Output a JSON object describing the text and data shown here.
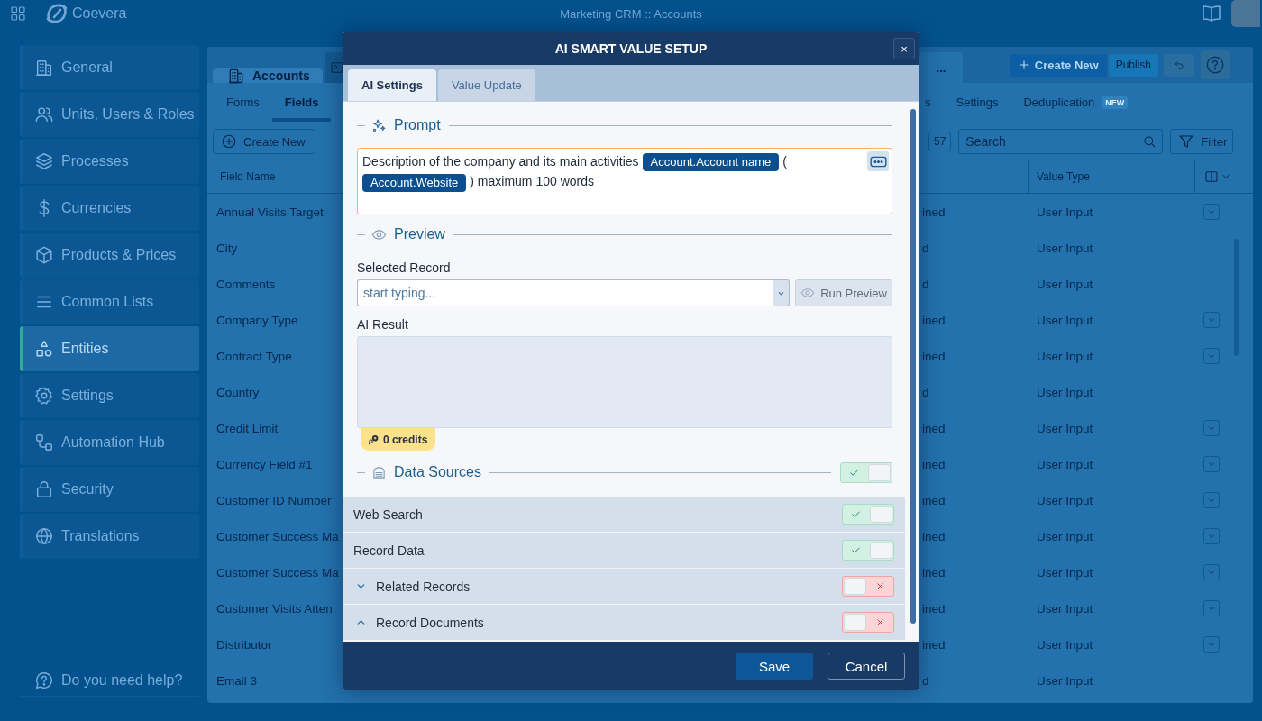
{
  "app": {
    "brand": "Coevera",
    "title": "Marketing CRM :: Accounts"
  },
  "sidebar": {
    "items": [
      {
        "label": "General",
        "selected": false
      },
      {
        "label": "Units, Users & Roles",
        "selected": false
      },
      {
        "label": "Processes",
        "selected": false
      },
      {
        "label": "Currencies",
        "selected": false
      },
      {
        "label": "Products & Prices",
        "selected": false
      },
      {
        "label": "Common Lists",
        "selected": false
      },
      {
        "label": "Entities",
        "selected": true
      },
      {
        "label": "Settings",
        "selected": false
      },
      {
        "label": "Automation Hub",
        "selected": false
      },
      {
        "label": "Security",
        "selected": false
      },
      {
        "label": "Translations",
        "selected": false
      }
    ],
    "help": "Do you need help?"
  },
  "main": {
    "tabs": [
      {
        "label": "Accounts",
        "selected": true
      },
      {
        "selected": false
      }
    ],
    "more_tabs": "...",
    "actions": [
      {
        "kind": "add",
        "label": "Create New",
        "disabled": false
      },
      {
        "kind": "plain",
        "label": "Publish",
        "disabled": true
      }
    ],
    "subtabs": [
      {
        "label": "Forms",
        "selected": false
      },
      {
        "label": "Fields",
        "selected": true
      },
      {
        "label": "s",
        "selected": false
      },
      {
        "label": "Settings",
        "selected": false
      },
      {
        "label": "Deduplication",
        "selected": false,
        "badge": "NEW"
      }
    ],
    "toolbar": {
      "create": "Create New",
      "count": "57",
      "search_placeholder": "Search",
      "filter": "Filter"
    },
    "table": {
      "columns": [
        "Field Name",
        "Value Type"
      ],
      "rows": [
        {
          "field_name": "Annual Visits Target",
          "column_3": "ined",
          "value_type": "User Input",
          "menu": true
        },
        {
          "field_name": "City",
          "column_3": "d",
          "value_type": "User Input",
          "menu": false
        },
        {
          "field_name": "Comments",
          "column_3": "d",
          "value_type": "User Input",
          "menu": false
        },
        {
          "field_name": "Company Type",
          "column_3": "ined",
          "value_type": "User Input",
          "menu": true
        },
        {
          "field_name": "Contract Type",
          "column_3": "ined",
          "value_type": "User Input",
          "menu": true
        },
        {
          "field_name": "Country",
          "column_3": "d",
          "value_type": "User Input",
          "menu": false
        },
        {
          "field_name": "Credit Limit",
          "column_3": "ined",
          "value_type": "User Input",
          "menu": true
        },
        {
          "field_name": "Currency Field #1",
          "column_3": "ined",
          "value_type": "User Input",
          "menu": true
        },
        {
          "field_name": "Customer ID Number",
          "column_3": "ined",
          "value_type": "User Input",
          "menu": true
        },
        {
          "field_name": "Customer Success Ma",
          "column_3": "ined",
          "value_type": "User Input",
          "menu": true
        },
        {
          "field_name": "Customer Success Ma",
          "column_3": "ined",
          "value_type": "User Input",
          "menu": true
        },
        {
          "field_name": "Customer Visits Atten",
          "column_3": "ined",
          "value_type": "User Input",
          "menu": true
        },
        {
          "field_name": "Distributor",
          "column_3": "ined",
          "value_type": "User Input",
          "menu": true
        },
        {
          "field_name": "Email 3",
          "column_3": "d",
          "value_type": "User Input",
          "menu": false
        }
      ]
    }
  },
  "dialog": {
    "title": "AI SMART VALUE SETUP",
    "close": "×",
    "tabs": [
      {
        "label": "AI Settings",
        "selected": true
      },
      {
        "label": "Value Update",
        "selected": false
      }
    ],
    "prompt": {
      "heading": "Prompt",
      "parts": [
        {
          "kind": "text",
          "text": "Description of the company and its main activities"
        },
        {
          "kind": "chip",
          "text": "Account.Account name"
        },
        {
          "kind": "text",
          "text": "("
        },
        {
          "kind": "chip",
          "text": "Account.Website"
        },
        {
          "kind": "text",
          "text": ") maximum 100 words"
        }
      ]
    },
    "preview": {
      "heading": "Preview",
      "record_label": "Selected Record",
      "record_placeholder": "start typing...",
      "run_button": {
        "label": "Run Preview",
        "disabled": true
      },
      "result_label": "AI Result",
      "credits": "0 credits"
    },
    "data_sources": {
      "heading": "Data Sources",
      "on": true,
      "items": [
        {
          "kind": "plain",
          "label": "Web Search",
          "on": true
        },
        {
          "kind": "plain",
          "label": "Record Data",
          "on": true
        },
        {
          "kind": "group",
          "label": "Related Records",
          "on": false,
          "expanded": false
        },
        {
          "kind": "group",
          "label": "Record Documents",
          "on": false,
          "expanded": true
        }
      ]
    },
    "buttons": [
      {
        "kind": "primary",
        "label": "Save"
      },
      {
        "kind": "secondary",
        "label": "Cancel"
      }
    ]
  }
}
